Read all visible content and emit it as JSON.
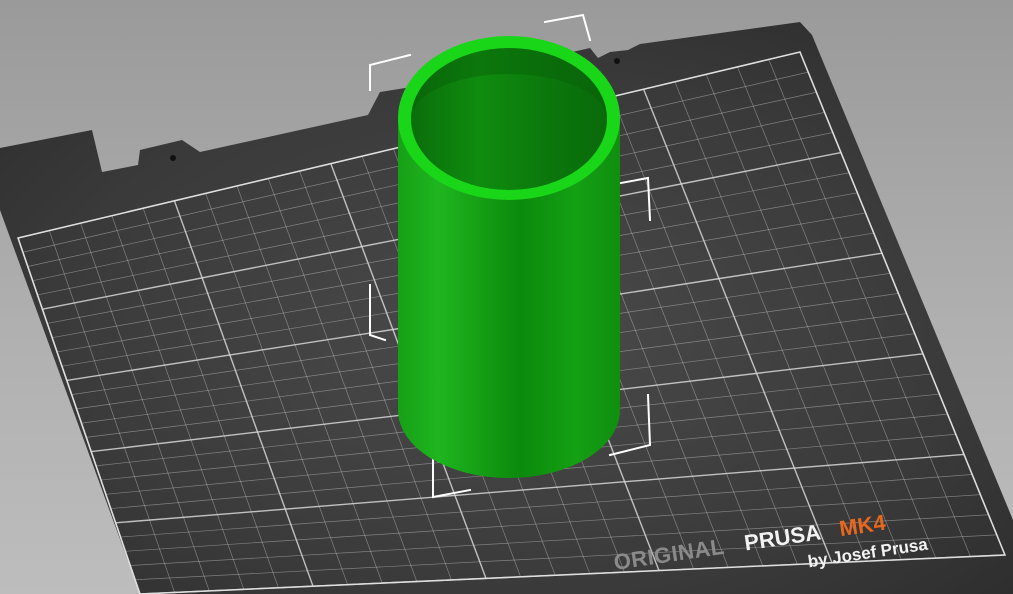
{
  "bed": {
    "brand_original": "ORIGINAL",
    "brand_prusa": "PRUSA",
    "brand_model": "MK4",
    "brand_byline": "by Josef Prusa"
  },
  "colors": {
    "bed_plate": "#2d2d2d",
    "grid_line": "#d8d8d8",
    "model_body": "#1a9a1a",
    "model_rim": "#19d619",
    "selection_box": "#ffffff",
    "brand_orange": "#e8671c"
  },
  "model": {
    "shape": "hollow-cylinder",
    "selected": true
  }
}
